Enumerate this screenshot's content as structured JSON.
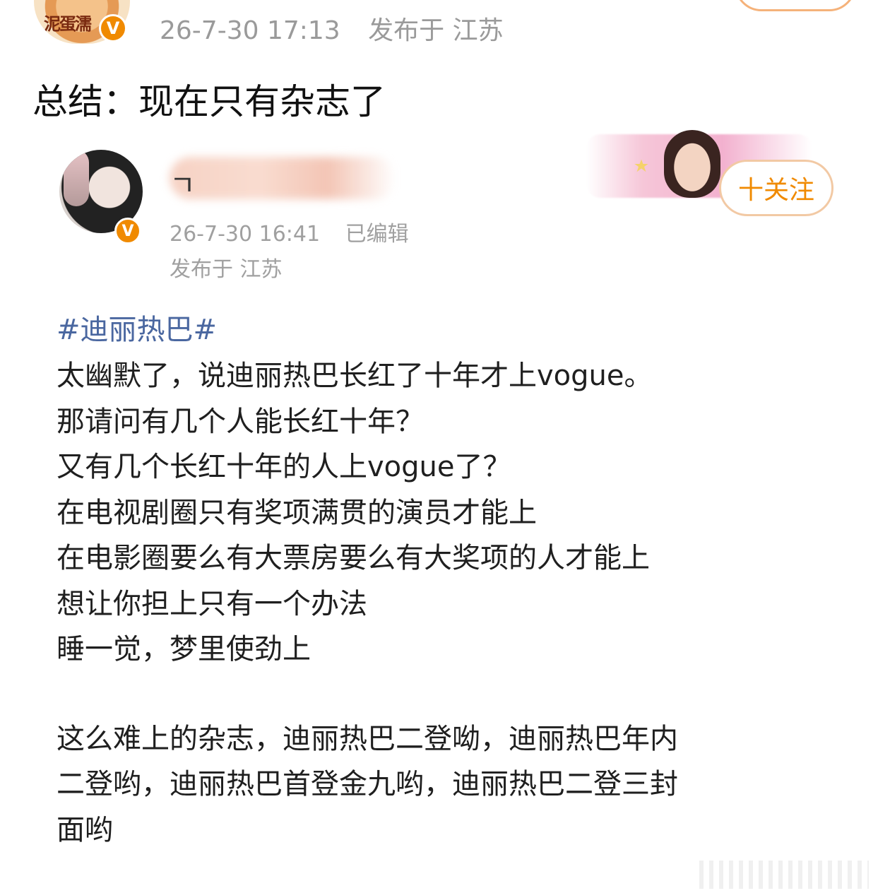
{
  "outer_post": {
    "avatar_text": "泥蛋濡",
    "timestamp": "26-7-30 17:13",
    "location": "发布于 江苏",
    "summary": "总结：现在只有杂志了"
  },
  "inner_post": {
    "username_visible": "ㄱ",
    "timestamp": "26-7-30 16:41",
    "edited_label": "已编辑",
    "location": "发布于 江苏",
    "follow_label": "十关注",
    "topic": "#迪丽热巴#",
    "lines": [
      "太幽默了，说迪丽热巴长红了十年才上vogue。",
      "那请问有几个人能长红十年？",
      "又有几个长红十年的人上vogue了？",
      "在电视剧圈只有奖项满贯的演员才能上",
      "在电影圈要么有大票房要么有大奖项的人才能上",
      "想让你担上只有一个办法",
      "睡一觉，梦里使劲上"
    ],
    "lines2": [
      "这么难上的杂志，迪丽热巴二登呦，迪丽热巴年内",
      "二登哟，迪丽热巴首登金九哟，迪丽热巴二登三封",
      "面哟"
    ]
  },
  "colors": {
    "accent": "#f08a00",
    "topic": "#4a67a0",
    "meta": "#9a9a9a"
  }
}
